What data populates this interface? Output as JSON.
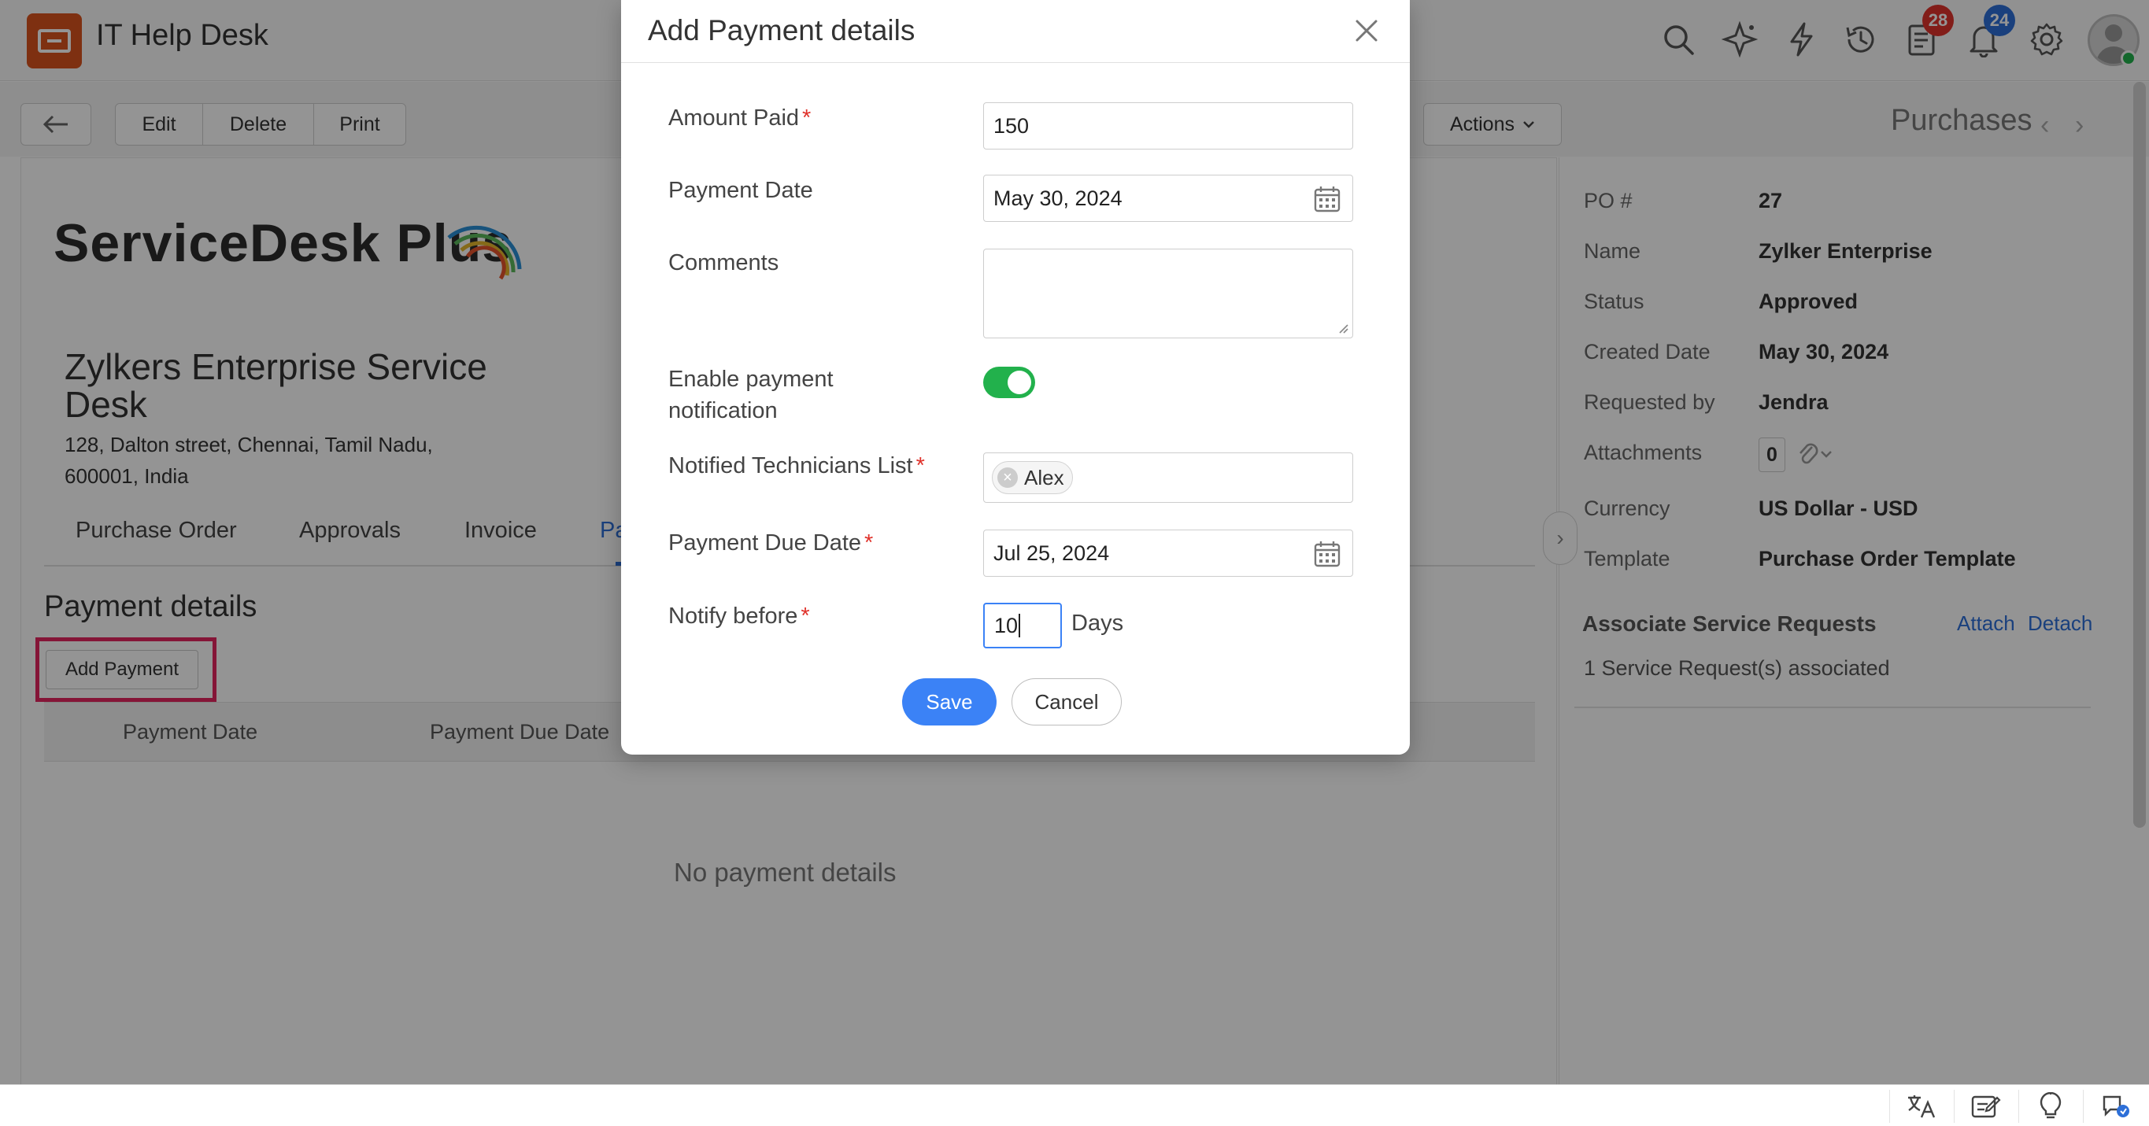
{
  "app": {
    "title": "IT Help Desk"
  },
  "topbar": {
    "icons": [
      "search-icon",
      "sparkle-icon",
      "lightning-icon",
      "history-icon",
      "tasks-icon",
      "bell-icon",
      "gear-icon",
      "avatar"
    ],
    "tasks_badge": "28",
    "notifications_badge": "24"
  },
  "toolbar": {
    "edit_label": "Edit",
    "delete_label": "Delete",
    "print_label": "Print",
    "actions_label": "Actions",
    "module_title": "Purchases"
  },
  "main": {
    "brand": "ServiceDesk Plus",
    "org_name": "Zylkers Enterprise Service Desk",
    "org_address": "128, Dalton street, Chennai, Tamil Nadu, 600001, India",
    "tabs": [
      {
        "label": "Purchase Order"
      },
      {
        "label": "Approvals"
      },
      {
        "label": "Invoice"
      },
      {
        "label": "Pa"
      }
    ],
    "section_title": "Payment details",
    "add_payment_label": "Add Payment",
    "table_headers": [
      "Payment Date",
      "Payment Due Date"
    ],
    "empty_message": "No payment details"
  },
  "details": {
    "rows": [
      {
        "label": "PO #",
        "value": "27"
      },
      {
        "label": "Name",
        "value": "Zylker Enterprise"
      },
      {
        "label": "Status",
        "value": "Approved"
      },
      {
        "label": "Created Date",
        "value": "May 30, 2024"
      },
      {
        "label": "Requested by",
        "value": "Jendra"
      },
      {
        "label": "Attachments",
        "value": "0"
      },
      {
        "label": "Currency",
        "value": "US Dollar - USD"
      },
      {
        "label": "Template",
        "value": "Purchase Order Template"
      }
    ],
    "associate_title": "Associate Service Requests",
    "attach_label": "Attach",
    "detach_label": "Detach",
    "associated_text": "1 Service Request(s) associated"
  },
  "modal": {
    "title": "Add Payment details",
    "amount_label": "Amount Paid",
    "amount_value": "150",
    "payment_date_label": "Payment Date",
    "payment_date_value": "May 30, 2024",
    "comments_label": "Comments",
    "comments_value": "",
    "notification_label": "Enable payment notification",
    "notification_enabled": true,
    "technicians_label": "Notified Technicians List",
    "technicians": [
      "Alex"
    ],
    "due_date_label": "Payment Due Date",
    "due_date_value": "Jul 25, 2024",
    "notify_before_label": "Notify before",
    "notify_before_value": "10",
    "days_label": "Days",
    "required_marker": "*",
    "save_label": "Save",
    "cancel_label": "Cancel"
  },
  "colors": {
    "brand": "#d9531e",
    "primary": "#3b82f6",
    "toggle_on": "#22b14c",
    "required": "#e0322b",
    "highlight": "#e5255f"
  },
  "bottombar": {
    "icons": [
      "translate-icon",
      "note-icon",
      "bulb-icon",
      "chat-icon"
    ]
  }
}
